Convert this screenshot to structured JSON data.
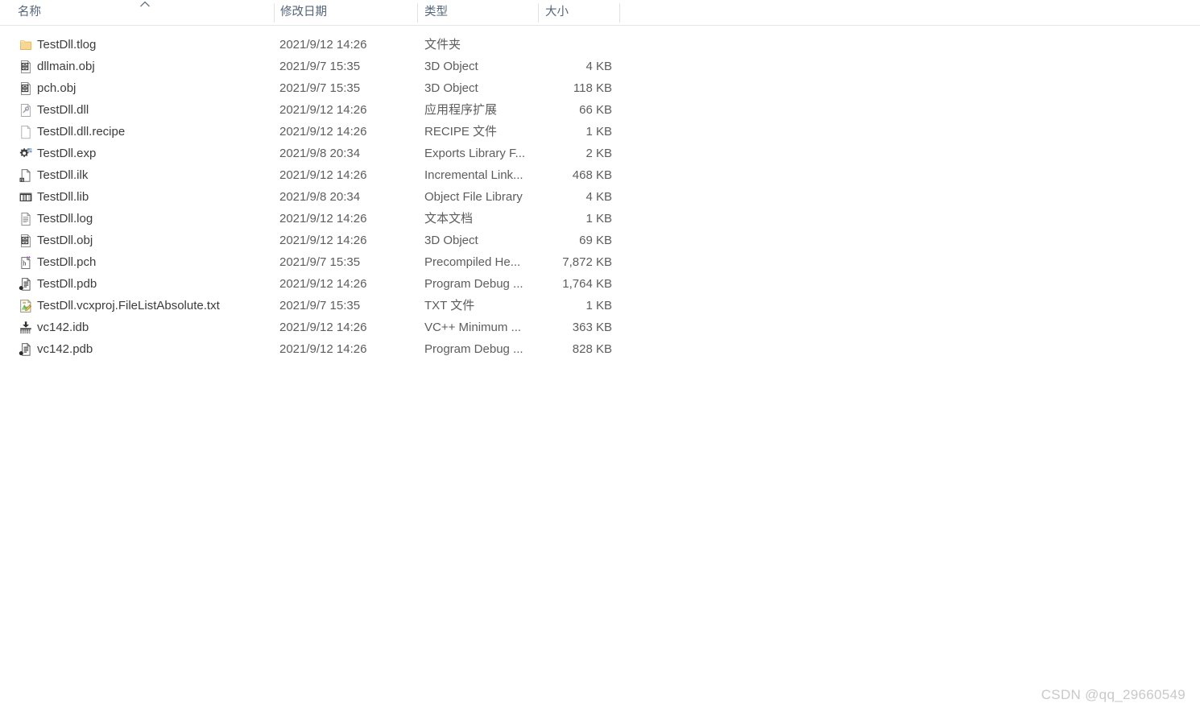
{
  "header": {
    "columns": [
      {
        "label": "名称",
        "key": "name"
      },
      {
        "label": "修改日期",
        "key": "date"
      },
      {
        "label": "类型",
        "key": "type"
      },
      {
        "label": "大小",
        "key": "size"
      }
    ],
    "sort": {
      "column": "名称",
      "direction": "ascending",
      "icon": "chevron-up-icon"
    }
  },
  "files": [
    {
      "name": "TestDll.tlog",
      "date": "2021/9/12 14:26",
      "type": "文件夹",
      "size": "",
      "icon": "folder-icon"
    },
    {
      "name": "dllmain.obj",
      "date": "2021/9/7 15:35",
      "type": "3D Object",
      "size": "4 KB",
      "icon": "3d-object-icon"
    },
    {
      "name": "pch.obj",
      "date": "2021/9/7 15:35",
      "type": "3D Object",
      "size": "118 KB",
      "icon": "3d-object-icon"
    },
    {
      "name": "TestDll.dll",
      "date": "2021/9/12 14:26",
      "type": "应用程序扩展",
      "size": "66 KB",
      "icon": "dll-icon"
    },
    {
      "name": "TestDll.dll.recipe",
      "date": "2021/9/12 14:26",
      "type": "RECIPE 文件",
      "size": "1 KB",
      "icon": "blank-document-icon"
    },
    {
      "name": "TestDll.exp",
      "date": "2021/9/8 20:34",
      "type": "Exports Library F...",
      "size": "2 KB",
      "icon": "gears-icon"
    },
    {
      "name": "TestDll.ilk",
      "date": "2021/9/12 14:26",
      "type": "Incremental Link...",
      "size": "468 KB",
      "icon": "linker-document-icon"
    },
    {
      "name": "TestDll.lib",
      "date": "2021/9/8 20:34",
      "type": "Object File Library",
      "size": "4 KB",
      "icon": "library-icon"
    },
    {
      "name": "TestDll.log",
      "date": "2021/9/12 14:26",
      "type": "文本文档",
      "size": "1 KB",
      "icon": "text-document-icon"
    },
    {
      "name": "TestDll.obj",
      "date": "2021/9/12 14:26",
      "type": "3D Object",
      "size": "69 KB",
      "icon": "3d-object-icon"
    },
    {
      "name": "TestDll.pch",
      "date": "2021/9/7 15:35",
      "type": "Precompiled He...",
      "size": "7,872 KB",
      "icon": "precompiled-header-icon"
    },
    {
      "name": "TestDll.pdb",
      "date": "2021/9/12 14:26",
      "type": "Program Debug ...",
      "size": "1,764 KB",
      "icon": "program-debug-icon"
    },
    {
      "name": "TestDll.vcxproj.FileListAbsolute.txt",
      "date": "2021/9/7 15:35",
      "type": "TXT 文件",
      "size": "1 KB",
      "icon": "txt-editor-icon"
    },
    {
      "name": "vc142.idb",
      "date": "2021/9/12 14:26",
      "type": "VC++ Minimum ...",
      "size": "363 KB",
      "icon": "idb-database-icon"
    },
    {
      "name": "vc142.pdb",
      "date": "2021/9/12 14:26",
      "type": "Program Debug ...",
      "size": "828 KB",
      "icon": "program-debug-icon"
    }
  ],
  "watermark": {
    "text": "CSDN @qq_29660549"
  },
  "colors": {
    "header_text": "#54657a",
    "name_text": "#3c3c3c",
    "meta_text": "#5d5d5d",
    "divider": "#e2e2e2",
    "folder": "#f5c977",
    "watermark": "#c9c9c9"
  }
}
